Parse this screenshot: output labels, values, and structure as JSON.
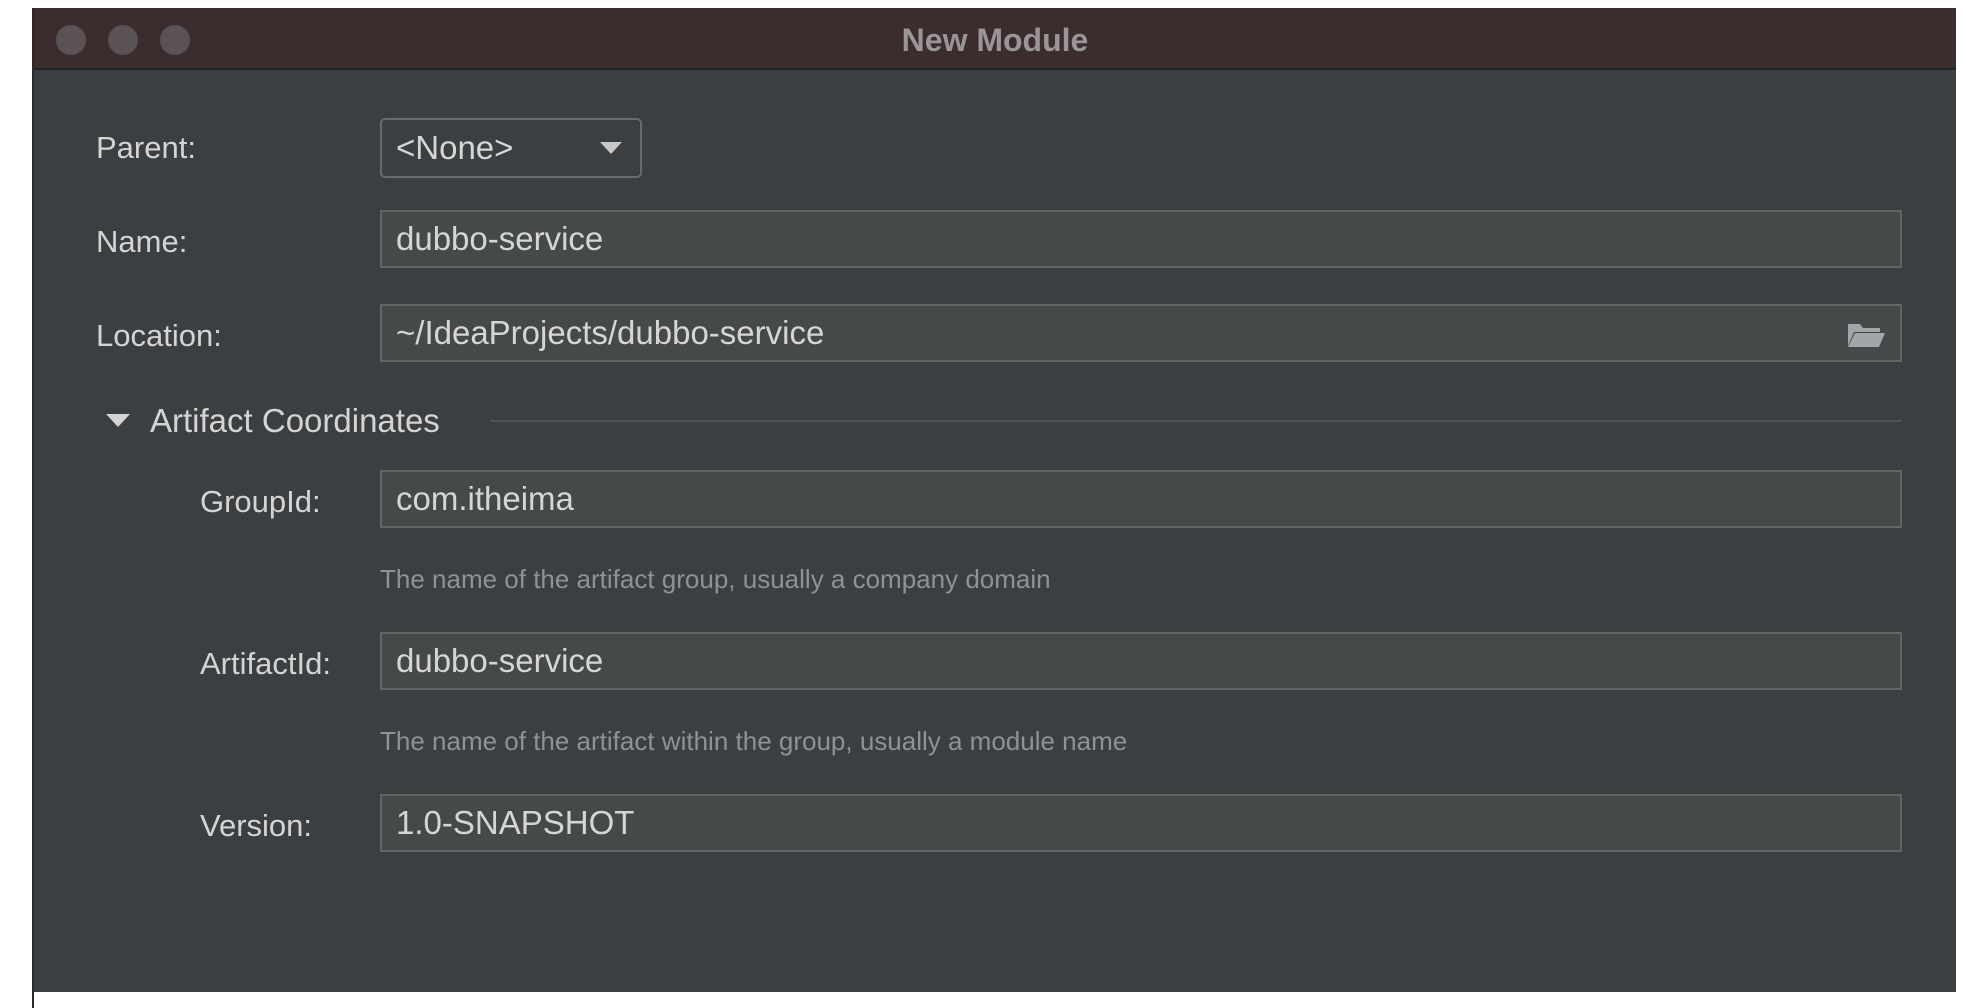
{
  "window": {
    "title": "New Module"
  },
  "form": {
    "parent": {
      "label": "Parent:",
      "value": "<None>"
    },
    "name": {
      "label": "Name:",
      "value": "dubbo-service"
    },
    "location": {
      "label": "Location:",
      "value": "~/IdeaProjects/dubbo-service"
    },
    "section": {
      "title": "Artifact Coordinates",
      "expanded": true,
      "groupId": {
        "label": "GroupId:",
        "value": "com.itheima",
        "hint": "The name of the artifact group, usually a company domain"
      },
      "artifactId": {
        "label": "ArtifactId:",
        "value": "dubbo-service",
        "hint": "The name of the artifact within the group, usually a module name"
      },
      "version": {
        "label": "Version:",
        "value": "1.0-SNAPSHOT"
      }
    }
  },
  "icons": {
    "dropdown": "chevron-down-icon",
    "browse": "folder-icon",
    "section_toggle": "triangle-down-icon"
  },
  "colors": {
    "background": "#3c3f41",
    "titlebar": "#3b2d2e",
    "field_bg": "#45494a",
    "text": "#d4d4d4",
    "hint_text": "#8f9294"
  }
}
